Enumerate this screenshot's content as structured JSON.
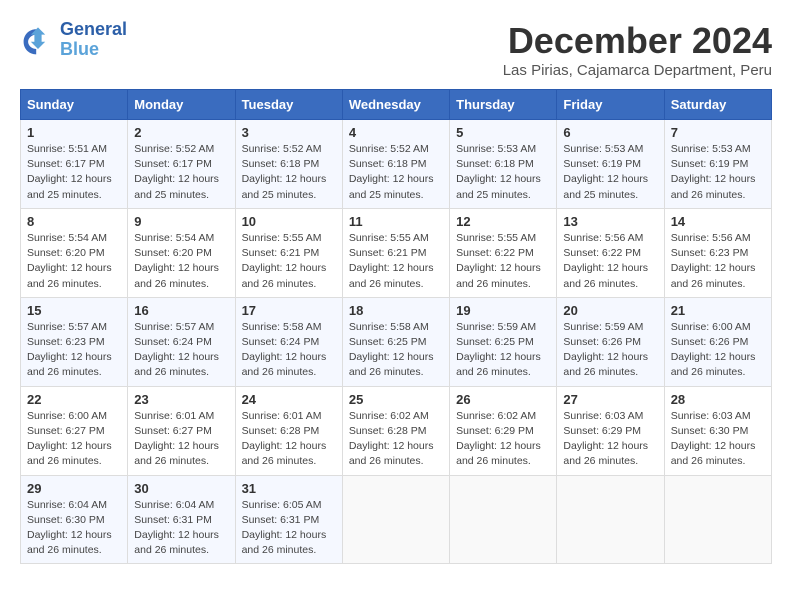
{
  "logo": {
    "text_line1": "General",
    "text_line2": "Blue"
  },
  "header": {
    "month_title": "December 2024",
    "location": "Las Pirias, Cajamarca Department, Peru"
  },
  "weekdays": [
    "Sunday",
    "Monday",
    "Tuesday",
    "Wednesday",
    "Thursday",
    "Friday",
    "Saturday"
  ],
  "weeks": [
    [
      {
        "day": "1",
        "info": "Sunrise: 5:51 AM\nSunset: 6:17 PM\nDaylight: 12 hours\nand 25 minutes."
      },
      {
        "day": "2",
        "info": "Sunrise: 5:52 AM\nSunset: 6:17 PM\nDaylight: 12 hours\nand 25 minutes."
      },
      {
        "day": "3",
        "info": "Sunrise: 5:52 AM\nSunset: 6:18 PM\nDaylight: 12 hours\nand 25 minutes."
      },
      {
        "day": "4",
        "info": "Sunrise: 5:52 AM\nSunset: 6:18 PM\nDaylight: 12 hours\nand 25 minutes."
      },
      {
        "day": "5",
        "info": "Sunrise: 5:53 AM\nSunset: 6:18 PM\nDaylight: 12 hours\nand 25 minutes."
      },
      {
        "day": "6",
        "info": "Sunrise: 5:53 AM\nSunset: 6:19 PM\nDaylight: 12 hours\nand 25 minutes."
      },
      {
        "day": "7",
        "info": "Sunrise: 5:53 AM\nSunset: 6:19 PM\nDaylight: 12 hours\nand 26 minutes."
      }
    ],
    [
      {
        "day": "8",
        "info": "Sunrise: 5:54 AM\nSunset: 6:20 PM\nDaylight: 12 hours\nand 26 minutes."
      },
      {
        "day": "9",
        "info": "Sunrise: 5:54 AM\nSunset: 6:20 PM\nDaylight: 12 hours\nand 26 minutes."
      },
      {
        "day": "10",
        "info": "Sunrise: 5:55 AM\nSunset: 6:21 PM\nDaylight: 12 hours\nand 26 minutes."
      },
      {
        "day": "11",
        "info": "Sunrise: 5:55 AM\nSunset: 6:21 PM\nDaylight: 12 hours\nand 26 minutes."
      },
      {
        "day": "12",
        "info": "Sunrise: 5:55 AM\nSunset: 6:22 PM\nDaylight: 12 hours\nand 26 minutes."
      },
      {
        "day": "13",
        "info": "Sunrise: 5:56 AM\nSunset: 6:22 PM\nDaylight: 12 hours\nand 26 minutes."
      },
      {
        "day": "14",
        "info": "Sunrise: 5:56 AM\nSunset: 6:23 PM\nDaylight: 12 hours\nand 26 minutes."
      }
    ],
    [
      {
        "day": "15",
        "info": "Sunrise: 5:57 AM\nSunset: 6:23 PM\nDaylight: 12 hours\nand 26 minutes."
      },
      {
        "day": "16",
        "info": "Sunrise: 5:57 AM\nSunset: 6:24 PM\nDaylight: 12 hours\nand 26 minutes."
      },
      {
        "day": "17",
        "info": "Sunrise: 5:58 AM\nSunset: 6:24 PM\nDaylight: 12 hours\nand 26 minutes."
      },
      {
        "day": "18",
        "info": "Sunrise: 5:58 AM\nSunset: 6:25 PM\nDaylight: 12 hours\nand 26 minutes."
      },
      {
        "day": "19",
        "info": "Sunrise: 5:59 AM\nSunset: 6:25 PM\nDaylight: 12 hours\nand 26 minutes."
      },
      {
        "day": "20",
        "info": "Sunrise: 5:59 AM\nSunset: 6:26 PM\nDaylight: 12 hours\nand 26 minutes."
      },
      {
        "day": "21",
        "info": "Sunrise: 6:00 AM\nSunset: 6:26 PM\nDaylight: 12 hours\nand 26 minutes."
      }
    ],
    [
      {
        "day": "22",
        "info": "Sunrise: 6:00 AM\nSunset: 6:27 PM\nDaylight: 12 hours\nand 26 minutes."
      },
      {
        "day": "23",
        "info": "Sunrise: 6:01 AM\nSunset: 6:27 PM\nDaylight: 12 hours\nand 26 minutes."
      },
      {
        "day": "24",
        "info": "Sunrise: 6:01 AM\nSunset: 6:28 PM\nDaylight: 12 hours\nand 26 minutes."
      },
      {
        "day": "25",
        "info": "Sunrise: 6:02 AM\nSunset: 6:28 PM\nDaylight: 12 hours\nand 26 minutes."
      },
      {
        "day": "26",
        "info": "Sunrise: 6:02 AM\nSunset: 6:29 PM\nDaylight: 12 hours\nand 26 minutes."
      },
      {
        "day": "27",
        "info": "Sunrise: 6:03 AM\nSunset: 6:29 PM\nDaylight: 12 hours\nand 26 minutes."
      },
      {
        "day": "28",
        "info": "Sunrise: 6:03 AM\nSunset: 6:30 PM\nDaylight: 12 hours\nand 26 minutes."
      }
    ],
    [
      {
        "day": "29",
        "info": "Sunrise: 6:04 AM\nSunset: 6:30 PM\nDaylight: 12 hours\nand 26 minutes."
      },
      {
        "day": "30",
        "info": "Sunrise: 6:04 AM\nSunset: 6:31 PM\nDaylight: 12 hours\nand 26 minutes."
      },
      {
        "day": "31",
        "info": "Sunrise: 6:05 AM\nSunset: 6:31 PM\nDaylight: 12 hours\nand 26 minutes."
      },
      {
        "day": "",
        "info": ""
      },
      {
        "day": "",
        "info": ""
      },
      {
        "day": "",
        "info": ""
      },
      {
        "day": "",
        "info": ""
      }
    ]
  ]
}
